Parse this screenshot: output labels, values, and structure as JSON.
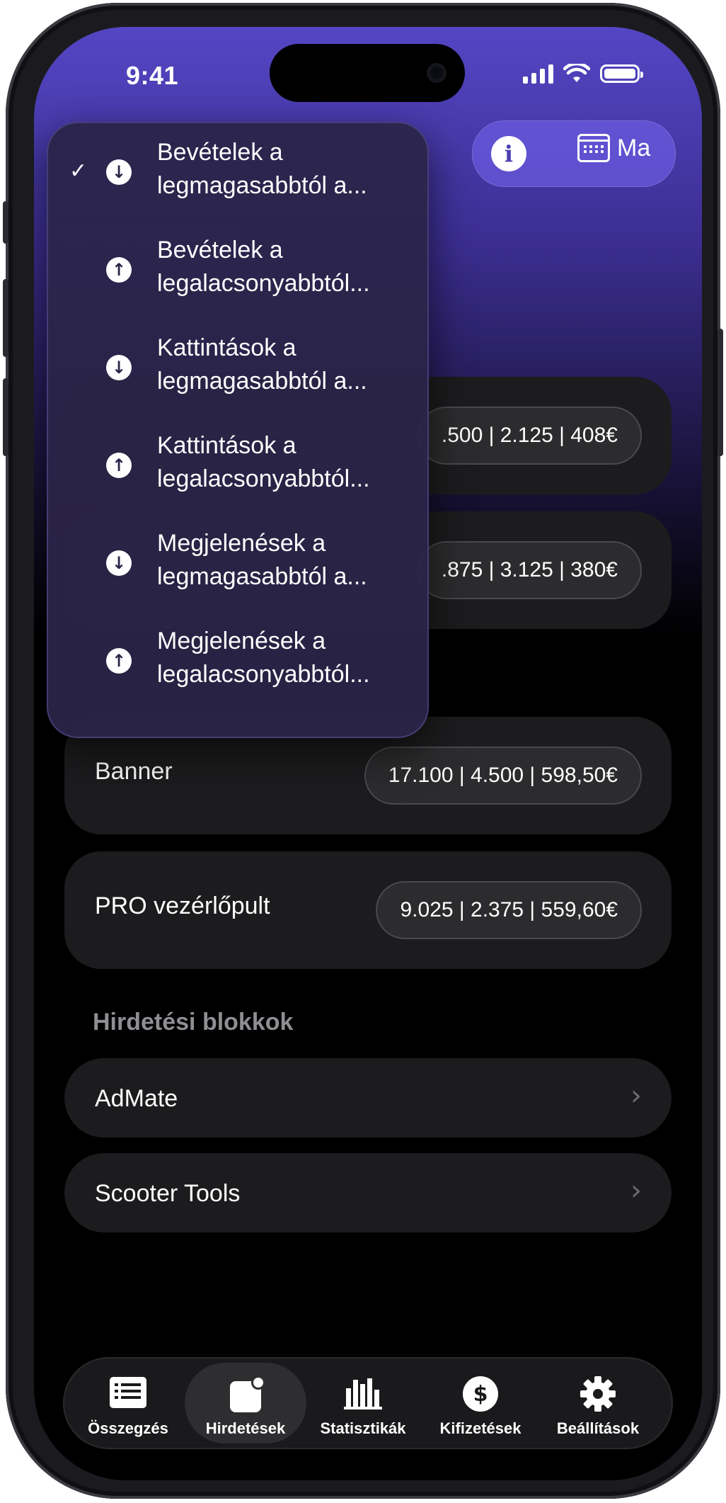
{
  "status": {
    "time": "9:41"
  },
  "header": {
    "calendar_label": "Ma"
  },
  "sort_menu": {
    "items": [
      {
        "line1": "Bevételek a",
        "line2": "legmagasabbtól a...",
        "direction": "down",
        "checked": true
      },
      {
        "line1": "Bevételek a",
        "line2": "legalacsonyabbtól...",
        "direction": "up",
        "checked": false
      },
      {
        "line1": "Kattintások a",
        "line2": "legmagasabbtól a...",
        "direction": "down",
        "checked": false
      },
      {
        "line1": "Kattintások a",
        "line2": "legalacsonyabbtól...",
        "direction": "up",
        "checked": false
      },
      {
        "line1": "Megjelenések a",
        "line2": "legmagasabbtól a...",
        "direction": "down",
        "checked": false
      },
      {
        "line1": "Megjelenések a",
        "line2": "legalacsonyabbtól...",
        "direction": "up",
        "checked": false
      }
    ],
    "check_glyph": "✓"
  },
  "ad_types": [
    {
      "label": "",
      "stats": ".500 | 2.125 | 408€"
    },
    {
      "label": "",
      "stats": ".875 | 3.125 | 380€"
    },
    {
      "label": "Banner",
      "stats": "17.100 | 4.500 | 598,50€"
    },
    {
      "label": "PRO vezérlőpult",
      "stats": "9.025 | 2.375 | 559,60€"
    }
  ],
  "ad_blocks": {
    "title": "Hirdetési blokkok",
    "items": [
      {
        "label": "AdMate"
      },
      {
        "label": "Scooter Tools"
      }
    ]
  },
  "tabs": [
    {
      "label": "Összegzés",
      "icon": "list-icon"
    },
    {
      "label": "Hirdetések",
      "icon": "ads-icon",
      "active": true
    },
    {
      "label": "Statisztikák",
      "icon": "bar-chart-icon"
    },
    {
      "label": "Kifizetések",
      "icon": "dollar-icon"
    },
    {
      "label": "Beállítások",
      "icon": "gear-icon"
    }
  ],
  "colors": {
    "accent": "#5446c4",
    "card": "#1c1c1e",
    "menu": "#2a2448"
  }
}
